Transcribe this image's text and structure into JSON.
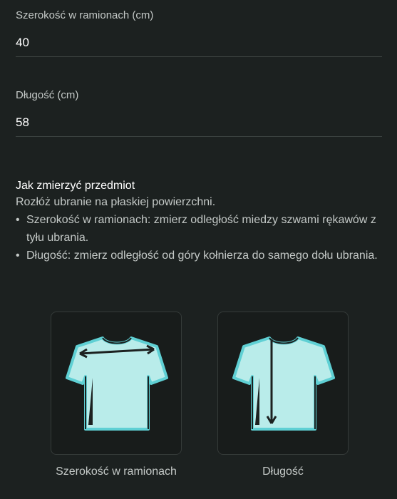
{
  "fields": [
    {
      "label": "Szerokość w ramionach (cm)",
      "value": "40"
    },
    {
      "label": "Długość (cm)",
      "value": "58"
    }
  ],
  "howto": {
    "title": "Jak zmierzyć przedmiot",
    "intro": "Rozłóż ubranie na płaskiej powierzchni.",
    "steps": [
      "Szerokość w ramionach: zmierz odległość miedzy szwami rękawów z tyłu ubrania.",
      "Długość: zmierz odległość od góry kołnierza do samego dołu ubrania."
    ]
  },
  "diagrams": [
    {
      "caption": "Szerokość w ramionach",
      "icon": "tshirt-shoulder-width-icon"
    },
    {
      "caption": "Długość",
      "icon": "tshirt-length-icon"
    }
  ],
  "colors": {
    "background": "#1c2120",
    "shirt_fill": "#b9ecea",
    "shirt_outline": "#5fd0d4",
    "measure_line": "#2b3331"
  }
}
